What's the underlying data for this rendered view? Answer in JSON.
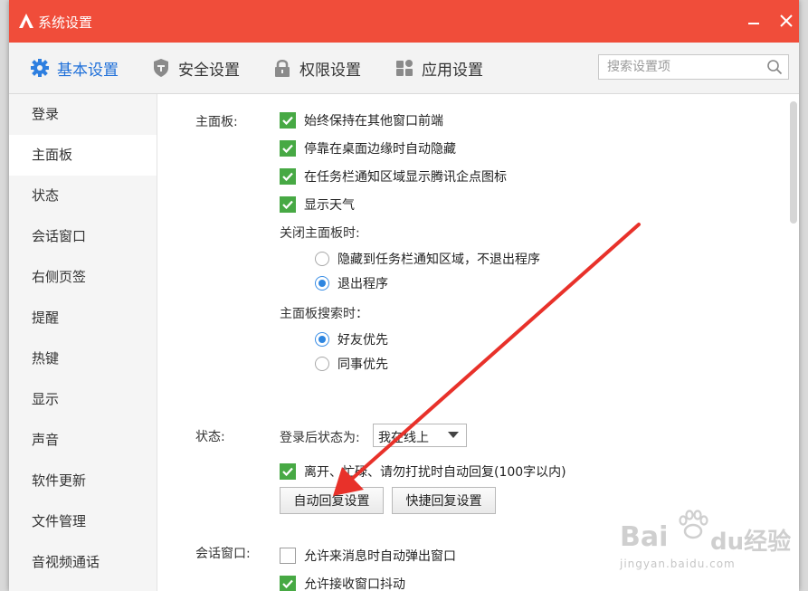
{
  "window": {
    "title": "系统设置"
  },
  "colors": {
    "titlebar": "#f04d3a",
    "accent": "#1e6fd9",
    "check_green": "#47a944",
    "radio_blue": "#2f86e0",
    "arrow_red": "#e8312a"
  },
  "tabs": [
    {
      "label": "基本设置",
      "icon": "gear-icon",
      "active": true
    },
    {
      "label": "安全设置",
      "icon": "shield-icon",
      "active": false
    },
    {
      "label": "权限设置",
      "icon": "lock-icon",
      "active": false
    },
    {
      "label": "应用设置",
      "icon": "apps-icon",
      "active": false
    }
  ],
  "search": {
    "placeholder": "搜索设置项",
    "value": ""
  },
  "sidebar": {
    "items": [
      {
        "label": "登录"
      },
      {
        "label": "主面板",
        "active": true
      },
      {
        "label": "状态"
      },
      {
        "label": "会话窗口"
      },
      {
        "label": "右侧页签"
      },
      {
        "label": "提醒"
      },
      {
        "label": "热键"
      },
      {
        "label": "显示"
      },
      {
        "label": "声音"
      },
      {
        "label": "软件更新"
      },
      {
        "label": "文件管理"
      },
      {
        "label": "音视频通话"
      }
    ]
  },
  "main_panel": {
    "label": "主面板:",
    "checkboxes": [
      {
        "label": "始终保持在其他窗口前端",
        "checked": true
      },
      {
        "label": "停靠在桌面边缘时自动隐藏",
        "checked": true
      },
      {
        "label": "在任务栏通知区域显示腾讯企点图标",
        "checked": true
      },
      {
        "label": "显示天气",
        "checked": true
      }
    ],
    "close_label": "关闭主面板时:",
    "close_options": [
      {
        "label": "隐藏到任务栏通知区域，不退出程序",
        "selected": false
      },
      {
        "label": "退出程序",
        "selected": true
      }
    ],
    "search_label": "主面板搜索时：",
    "search_options": [
      {
        "label": "好友优先",
        "selected": true
      },
      {
        "label": "同事优先",
        "selected": false
      }
    ]
  },
  "status": {
    "label": "状态:",
    "login_status_label": "登录后状态为:",
    "login_status_value": "我在线上",
    "auto_reply": {
      "label": "离开、忙碌、请勿打扰时自动回复(100字以内)",
      "checked": true
    },
    "auto_reply_button": "自动回复设置",
    "quick_reply_button": "快捷回复设置"
  },
  "chat_window": {
    "label": "会话窗口:",
    "checkboxes": [
      {
        "label": "允许来消息时自动弹出窗口",
        "checked": false
      },
      {
        "label": "允许接收窗口抖动",
        "checked": true
      }
    ]
  },
  "watermark": {
    "main_a": "Bai",
    "main_b": "du",
    "cn": "经验",
    "url": "jingyan.baidu.com"
  }
}
